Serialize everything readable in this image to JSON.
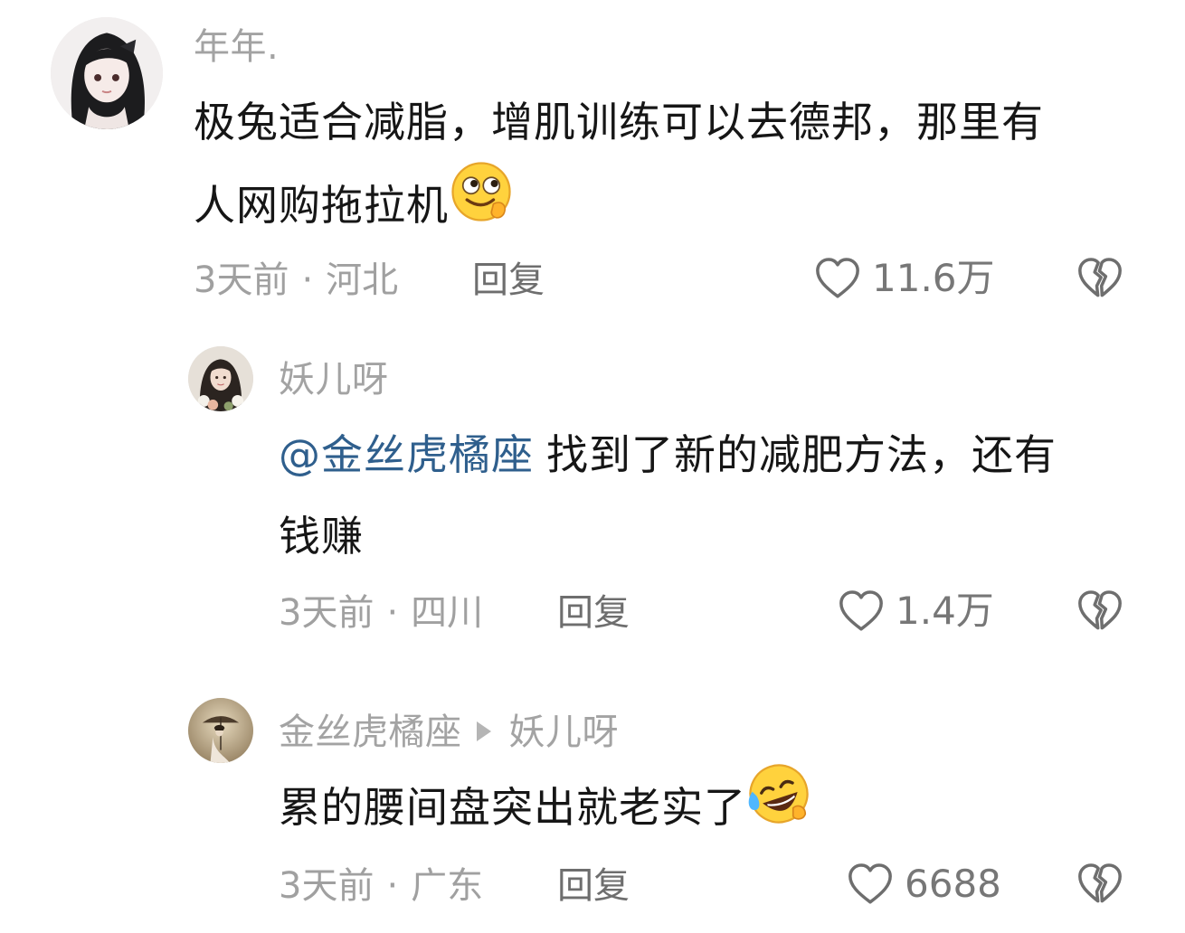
{
  "comments": [
    {
      "username": "年年.",
      "text_line1": "极兔适合减脂，增肌训练可以去德邦，那里有",
      "text_line2": "人网购拖拉机",
      "emoji": "thinking-smile-emoji",
      "time": "3天前",
      "dot": "·",
      "location": "河北",
      "reply_label": "回复",
      "likes": "11.6万",
      "avatar": "girl-dark-hair-avatar"
    },
    {
      "username": "妖儿呀",
      "mention": "@金丝虎橘座",
      "text_line1": "找到了新的减肥方法，还有",
      "text_line2": "钱赚",
      "time": "3天前",
      "dot": "·",
      "location": "四川",
      "reply_label": "回复",
      "likes": "1.4万",
      "avatar": "girl-flowers-avatar"
    },
    {
      "username": "金丝虎橘座",
      "reply_to": "妖儿呀",
      "text_line1": "累的腰间盘突出就老实了",
      "emoji": "rofl-emoji",
      "time": "3天前",
      "dot": "·",
      "location": "广东",
      "reply_label": "回复",
      "likes": "6688",
      "avatar": "umbrella-figure-avatar"
    }
  ],
  "colors": {
    "text": "#161616",
    "meta": "#a0a0a0",
    "mention": "#2f5f8d",
    "icon": "#6e6e6e"
  }
}
